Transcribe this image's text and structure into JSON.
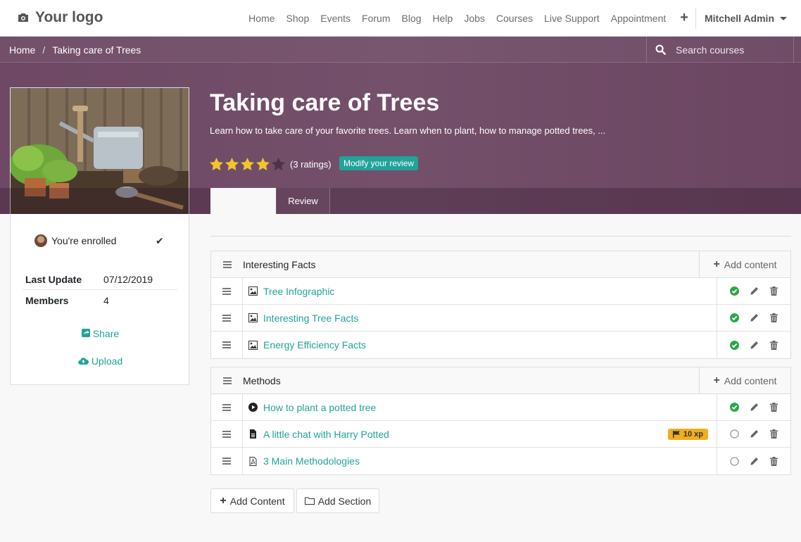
{
  "navbar": {
    "logo_text": "Your logo",
    "logo_icon": "camera-icon",
    "links": [
      "Home",
      "Shop",
      "Events",
      "Forum",
      "Blog",
      "Help",
      "Jobs",
      "Courses",
      "Live Support",
      "Appointment"
    ],
    "user": "Mitchell Admin"
  },
  "breadcrumb": {
    "home": "Home",
    "current": "Taking care of Trees"
  },
  "search": {
    "placeholder": "Search courses"
  },
  "course": {
    "title": "Taking care of Trees",
    "description": "Learn how to take care of your favorite trees. Learn when to plant, how to manage potted trees, ...",
    "rating_value": 4,
    "rating_max": 5,
    "ratings_text": "(3 ratings)",
    "review_button": "Modify your review"
  },
  "tabs": {
    "review": "Review"
  },
  "sidebar": {
    "enrolled_text": "You're enrolled",
    "last_update_label": "Last Update",
    "last_update_value": "07/12/2019",
    "members_label": "Members",
    "members_value": "4",
    "share": "Share",
    "upload": "Upload"
  },
  "add_content_label": "Add content",
  "sections": [
    {
      "title": "Interesting Facts",
      "items": [
        {
          "name": "Tree Infographic",
          "type": "image",
          "status": "done"
        },
        {
          "name": "Interesting Tree Facts",
          "type": "image",
          "status": "done"
        },
        {
          "name": "Energy Efficiency Facts",
          "type": "image",
          "status": "done"
        }
      ]
    },
    {
      "title": "Methods",
      "items": [
        {
          "name": "How to plant a potted tree",
          "type": "video",
          "status": "done"
        },
        {
          "name": "A little chat with Harry Potted",
          "type": "document",
          "status": "todo",
          "badge": "10 xp"
        },
        {
          "name": "3 Main Methodologies",
          "type": "pdf",
          "status": "todo"
        }
      ]
    }
  ],
  "buttons": {
    "add_content": "Add Content",
    "add_section": "Add Section"
  },
  "colors": {
    "hero": "#6e4864",
    "accent": "#21a398",
    "done": "#28a745",
    "xp_badge": "#f0ad1e"
  }
}
